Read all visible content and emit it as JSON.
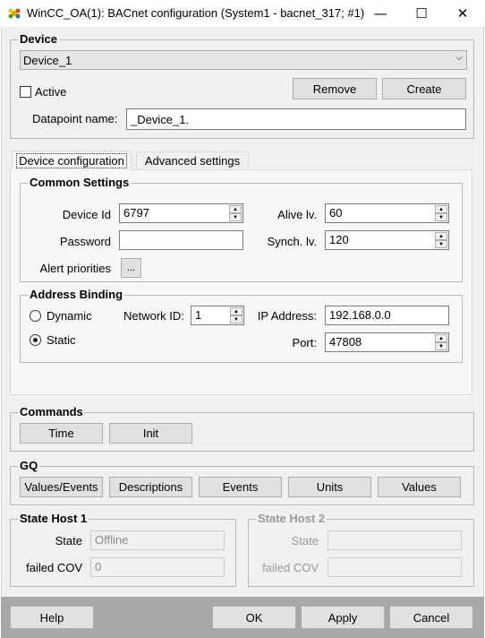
{
  "window": {
    "title": "WinCC_OA(1): BACnet configuration (System1 - bacnet_317; #1)",
    "minimize": "—",
    "maximize": "☐",
    "close": "✕"
  },
  "device": {
    "group_title": "Device",
    "selected": "Device_1",
    "active_label": "Active",
    "active_checked": false,
    "remove_label": "Remove",
    "create_label": "Create",
    "datapoint_label": "Datapoint name:",
    "datapoint_value": "_Device_1."
  },
  "tabs": [
    {
      "label": "Device configuration",
      "active": true
    },
    {
      "label": "Advanced settings",
      "active": false
    }
  ],
  "common": {
    "group_title": "Common Settings",
    "device_id_label": "Device Id",
    "device_id_value": "6797",
    "alive_label": "Alive lv.",
    "alive_value": "60",
    "password_label": "Password",
    "password_value": "",
    "synch_label": "Synch. lv.",
    "synch_value": "120",
    "alert_label": "Alert priorities",
    "alert_button": "..."
  },
  "address": {
    "group_title": "Address Binding",
    "dynamic_label": "Dynamic",
    "static_label": "Static",
    "selected": "Static",
    "network_label": "Network ID:",
    "network_value": "1",
    "ip_label": "IP Address:",
    "ip_value": "192.168.0.0",
    "port_label": "Port:",
    "port_value": "47808"
  },
  "commands": {
    "group_title": "Commands",
    "time_label": "Time",
    "init_label": "Init"
  },
  "gq": {
    "group_title": "GQ",
    "buttons": [
      "Values/Events",
      "Descriptions",
      "Events",
      "Units",
      "Values"
    ]
  },
  "host1": {
    "group_title": "State Host 1",
    "state_label": "State",
    "state_value": "Offline",
    "cov_label": "failed COV",
    "cov_value": "0"
  },
  "host2": {
    "group_title": "State Host 2",
    "state_label": "State",
    "state_value": "",
    "cov_label": "failed COV",
    "cov_value": ""
  },
  "footer": {
    "help_label": "Help",
    "ok_label": "OK",
    "apply_label": "Apply",
    "cancel_label": "Cancel"
  },
  "icons": {
    "app": "wincc-oa-app-icon",
    "spin_up": "▲",
    "spin_down": "▼",
    "combo_arrow": "⌵"
  }
}
